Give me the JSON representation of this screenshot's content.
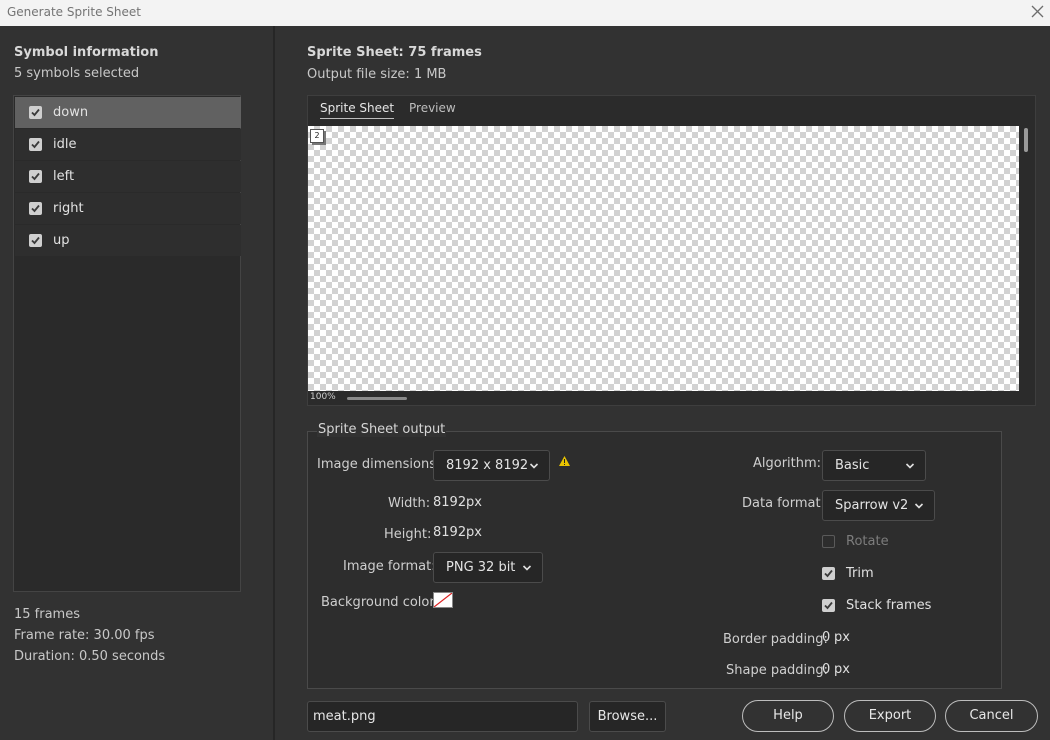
{
  "window": {
    "title": "Generate Sprite Sheet",
    "close_icon": "close-icon"
  },
  "symbol_info": {
    "heading": "Symbol information",
    "selected_count": "5 symbols selected",
    "symbols": [
      {
        "label": "down",
        "checked": true,
        "selected": true
      },
      {
        "label": "idle",
        "checked": true,
        "selected": false
      },
      {
        "label": "left",
        "checked": true,
        "selected": false
      },
      {
        "label": "right",
        "checked": true,
        "selected": false
      },
      {
        "label": "up",
        "checked": true,
        "selected": false
      }
    ],
    "frames": "15 frames",
    "frame_rate": "Frame rate: 30.00 fps",
    "duration": "Duration: 0.50 seconds"
  },
  "sheet": {
    "title": "Sprite Sheet: 75 frames",
    "output_size": "Output file size: 1 MB",
    "tabs": [
      "Sprite Sheet",
      "Preview"
    ],
    "active_tab": "Sprite Sheet",
    "frame_badge": "2",
    "zoom": "100%"
  },
  "output": {
    "legend": "Sprite Sheet output",
    "image_dimensions_label": "Image dimensions:",
    "image_dimensions_value": "8192 x 8192",
    "warning_icon": "warning-icon",
    "width_label": "Width:",
    "width_value": "8192",
    "width_unit": "px",
    "height_label": "Height:",
    "height_value": "8192",
    "height_unit": "px",
    "image_format_label": "Image format:",
    "image_format_value": "PNG 32 bit",
    "background_color_label": "Background color:",
    "algorithm_label": "Algorithm:",
    "algorithm_value": "Basic",
    "data_format_label": "Data format:",
    "data_format_value": "Sparrow v2",
    "rotate_label": "Rotate",
    "rotate_checked": false,
    "trim_label": "Trim",
    "trim_checked": true,
    "stack_frames_label": "Stack frames",
    "stack_frames_checked": true,
    "border_padding_label": "Border padding:",
    "border_padding_value": "0",
    "border_padding_unit": "px",
    "shape_padding_label": "Shape padding:",
    "shape_padding_value": "0",
    "shape_padding_unit": "px"
  },
  "footer": {
    "filename": "meat.png",
    "browse_label": "Browse...",
    "help_label": "Help",
    "export_label": "Export",
    "cancel_label": "Cancel"
  },
  "colors": {
    "accent_warning": "#e8c300",
    "panel_bg": "#323232",
    "selected_row": "#616161"
  }
}
